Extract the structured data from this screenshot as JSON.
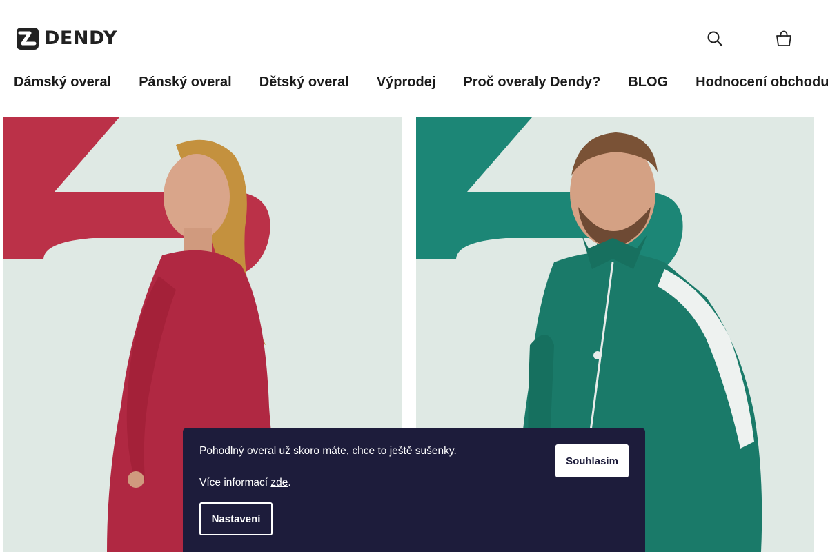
{
  "brand": {
    "name": "DENDY"
  },
  "header": {
    "lang_label": "",
    "icons": [
      "search-icon",
      "cart-icon"
    ]
  },
  "nav": {
    "items": [
      {
        "label": "Dámský overal"
      },
      {
        "label": "Pánský overal"
      },
      {
        "label": "Dětský overal"
      },
      {
        "label": "Výprodej"
      },
      {
        "label": "Proč overaly Dendy?"
      },
      {
        "label": "BLOG"
      },
      {
        "label": "Hodnocení obchodu"
      }
    ]
  },
  "hero": {
    "left_accent": "#c0304c",
    "right_accent": "#1f8a78",
    "background": "#dfe9e4"
  },
  "cookie": {
    "message": "Pohodlný overal už skoro máte, chce to ještě sušenky.",
    "more_prefix": "Více informací ",
    "more_link": "zde",
    "more_suffix": ".",
    "agree_label": "Souhlasím",
    "settings_label": "Nastavení"
  }
}
